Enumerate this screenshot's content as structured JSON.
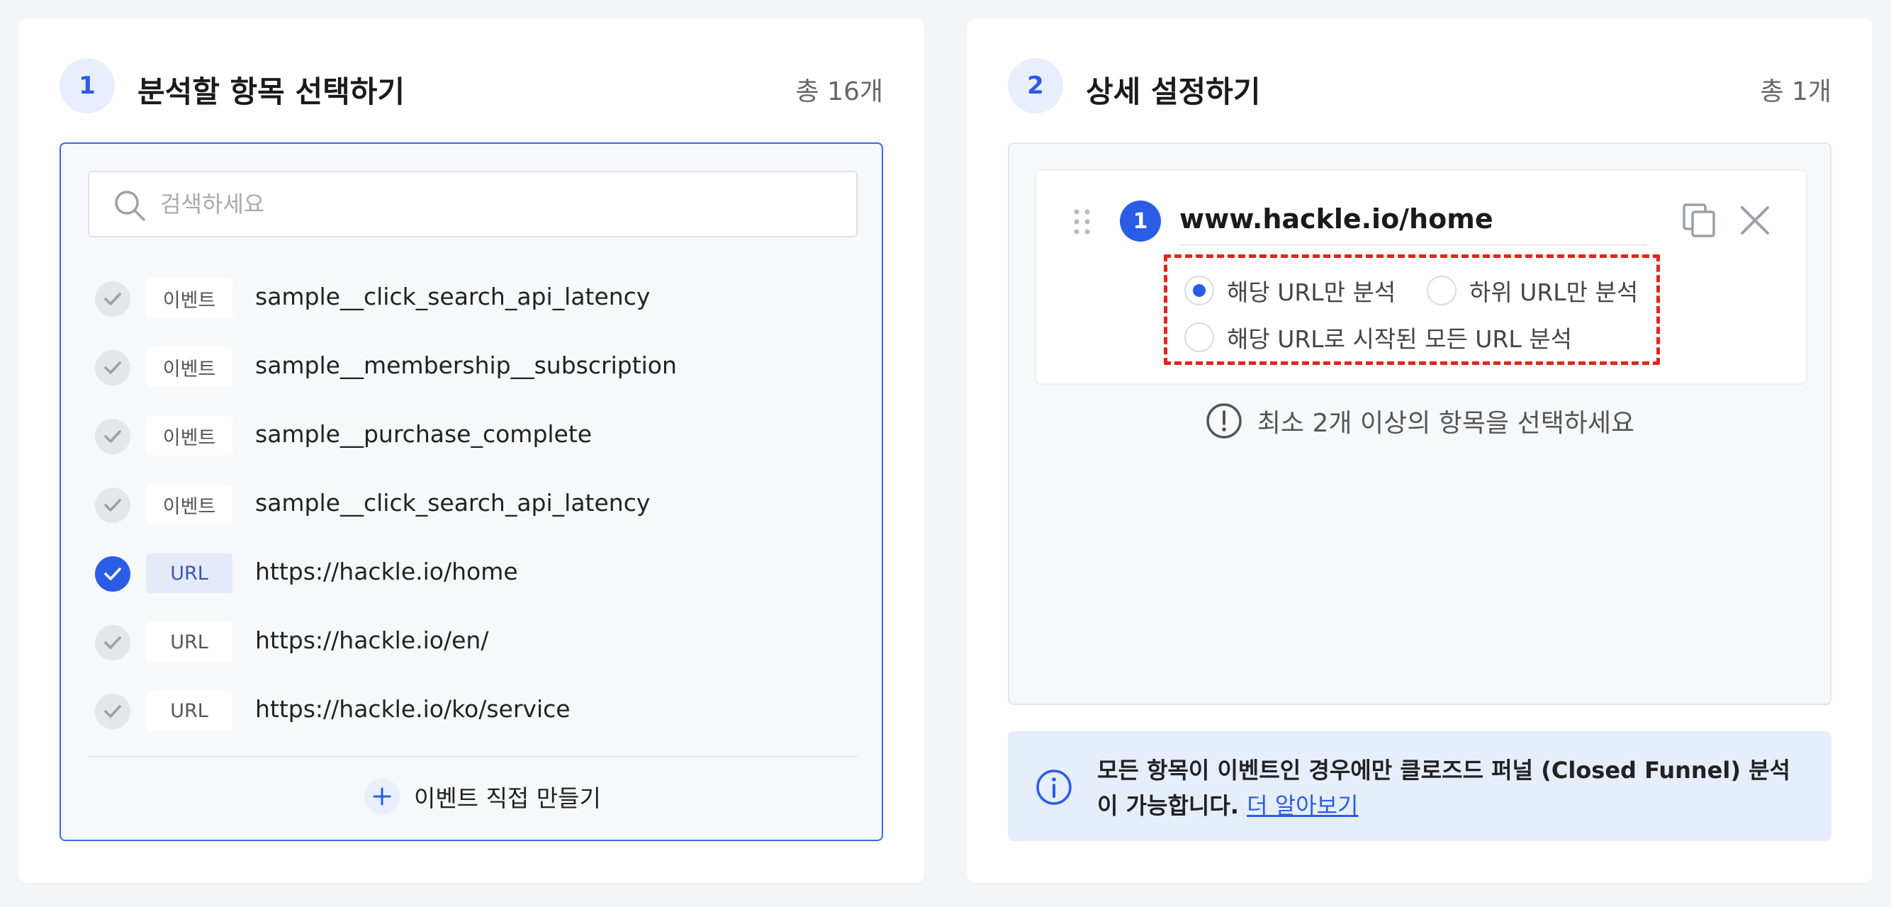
{
  "left_panel": {
    "step": "1",
    "title": "분석할 항목 선택하기",
    "count": "총 16개",
    "search": {
      "placeholder": "검색하세요",
      "value": ""
    },
    "items": [
      {
        "tag": "이벤트",
        "label": "sample__click_search_api_latency",
        "checked": false
      },
      {
        "tag": "이벤트",
        "label": "sample__membership__subscription",
        "checked": false
      },
      {
        "tag": "이벤트",
        "label": "sample__purchase_complete",
        "checked": false
      },
      {
        "tag": "이벤트",
        "label": "sample__click_search_api_latency",
        "checked": false
      },
      {
        "tag": "URL",
        "label": "https://hackle.io/home",
        "checked": true
      },
      {
        "tag": "URL",
        "label": "https://hackle.io/en/",
        "checked": false
      },
      {
        "tag": "URL",
        "label": "https://hackle.io/ko/service",
        "checked": false
      }
    ],
    "add_button_label": "이벤트 직접 만들기"
  },
  "right_panel": {
    "step": "2",
    "title": "상세 설정하기",
    "count": "총 1개",
    "card": {
      "number": "1",
      "title": "www.hackle.io/home",
      "options": [
        {
          "label": "해당 URL만 분석",
          "selected": true
        },
        {
          "label": "하위 URL만 분석",
          "selected": false
        },
        {
          "label": "해당 URL로 시작된 모든 URL 분석",
          "selected": false
        }
      ]
    },
    "warning": "최소 2개 이상의 항목을 선택하세요",
    "info": {
      "text": "모든 항목이 이벤트인 경우에만 클로즈드 퍼널 (Closed Funnel) 분석이 가능합니다.",
      "link": "더 알아보기"
    }
  },
  "colors": {
    "accent": "#2b5ce6",
    "highlight_border": "#e0261c",
    "info_bg": "#e6edfb"
  }
}
